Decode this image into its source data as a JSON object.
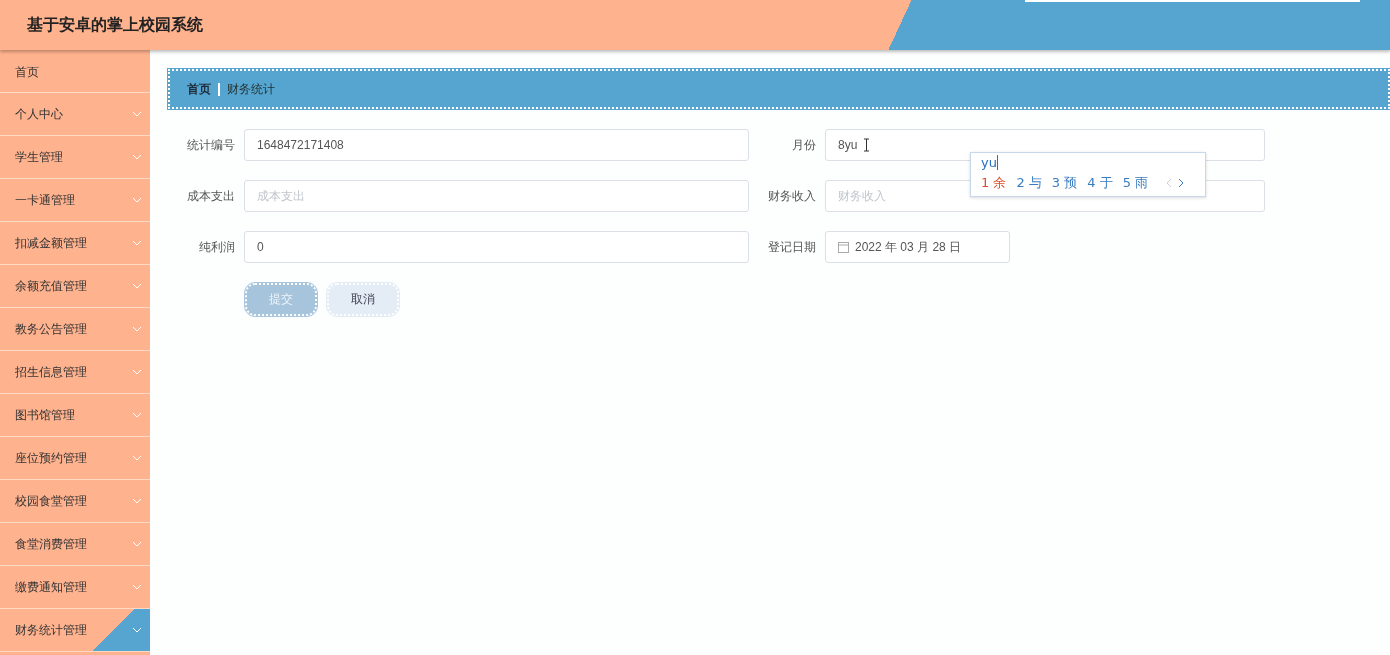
{
  "header": {
    "title": "基于安卓的掌上校园系统"
  },
  "sidebar": {
    "items": [
      {
        "label": "首页",
        "expandable": false,
        "selected": false
      },
      {
        "label": "个人中心",
        "expandable": true,
        "selected": false
      },
      {
        "label": "学生管理",
        "expandable": true,
        "selected": false
      },
      {
        "label": "一卡通管理",
        "expandable": true,
        "selected": false
      },
      {
        "label": "扣减金额管理",
        "expandable": true,
        "selected": false
      },
      {
        "label": "余额充值管理",
        "expandable": true,
        "selected": false
      },
      {
        "label": "教务公告管理",
        "expandable": true,
        "selected": false
      },
      {
        "label": "招生信息管理",
        "expandable": true,
        "selected": false
      },
      {
        "label": "图书馆管理",
        "expandable": true,
        "selected": false
      },
      {
        "label": "座位预约管理",
        "expandable": true,
        "selected": false
      },
      {
        "label": "校园食堂管理",
        "expandable": true,
        "selected": false
      },
      {
        "label": "食堂消费管理",
        "expandable": true,
        "selected": false
      },
      {
        "label": "缴费通知管理",
        "expandable": true,
        "selected": false
      },
      {
        "label": "财务统计管理",
        "expandable": true,
        "selected": true
      }
    ]
  },
  "breadcrumb": [
    "首页",
    "财务统计"
  ],
  "form": {
    "fields": [
      {
        "label": "统计编号",
        "value": "1648472171408",
        "kind": "text"
      },
      {
        "label": "月份",
        "value": "8yu",
        "kind": "text",
        "focused": true
      },
      {
        "label": "成本支出",
        "placeholder": "成本支出",
        "kind": "text"
      },
      {
        "label": "财务收入",
        "placeholder": "财务收入",
        "kind": "text"
      },
      {
        "label": "纯利润",
        "value": "0",
        "kind": "text"
      },
      {
        "label": "登记日期",
        "value": "2022 年 03 月 28 日",
        "kind": "date"
      }
    ],
    "buttons": [
      {
        "label": "提交",
        "kind": "primary"
      },
      {
        "label": "取消",
        "kind": "secondary"
      }
    ]
  },
  "ime_popup": {
    "composition": "yu",
    "candidates": [
      {
        "index": "1",
        "text": "余",
        "selected": true
      },
      {
        "index": "2",
        "text": "与",
        "selected": false
      },
      {
        "index": "3",
        "text": "预",
        "selected": false
      },
      {
        "index": "4",
        "text": "于",
        "selected": false
      },
      {
        "index": "5",
        "text": "雨",
        "selected": false
      }
    ]
  }
}
